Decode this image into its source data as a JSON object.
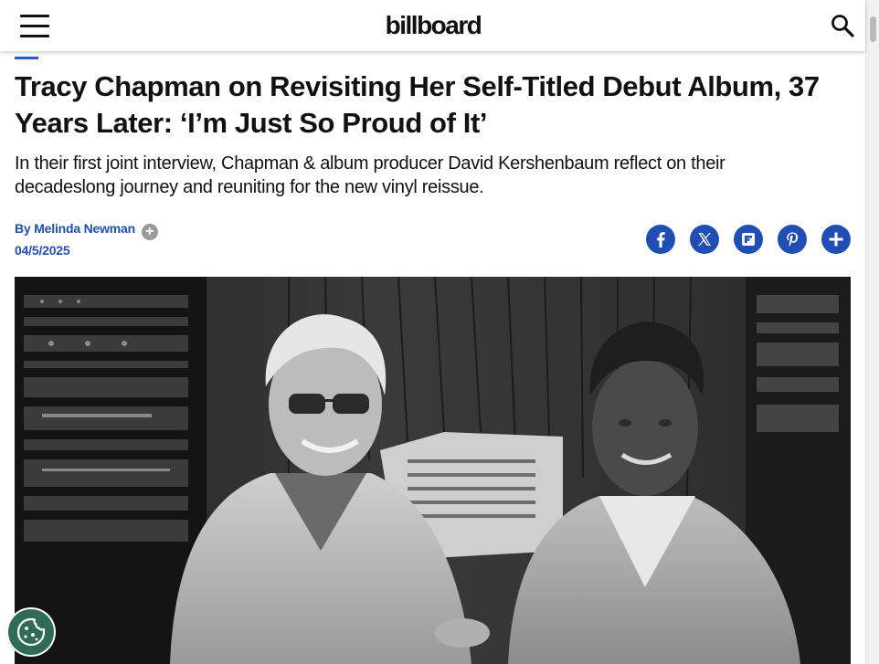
{
  "header": {
    "logo_text": "billboard",
    "menu_icon": "hamburger-menu-icon",
    "search_icon": "search-icon"
  },
  "article": {
    "headline": "Tracy Chapman on Revisiting Her Self-Titled Debut Album, 37 Years Later: ‘I’m Just So Proud of It’",
    "dek": "In their first joint interview, Chapman & album producer David Kershenbaum reflect on their decadeslong journey and reuniting for the new vinyl reissue.",
    "byline_prefix": "By",
    "author": "Melinda Newman",
    "follow_icon": "plus-icon",
    "date": "04/5/2025"
  },
  "share": {
    "items": [
      {
        "icon": "facebook-icon"
      },
      {
        "icon": "x-icon"
      },
      {
        "icon": "flipboard-icon"
      },
      {
        "icon": "pinterest-icon"
      },
      {
        "icon": "plus-icon"
      }
    ]
  },
  "hero_image": {
    "icon": "photo-black-and-white"
  },
  "cookie_button": {
    "icon": "cookie-icon"
  },
  "colors": {
    "accent": "#1f4fb5",
    "text": "#111111",
    "cookie_bg": "#2f6b57"
  }
}
